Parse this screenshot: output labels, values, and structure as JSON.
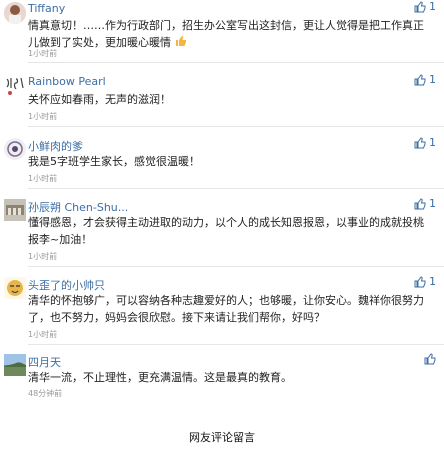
{
  "comments": [
    {
      "user": "Tiffany",
      "text": "情真意切！……作为行政部门，招生办公室写出这封信，更让人觉得是把工作真正儿做到了实处，更加暖心暖情",
      "emoji": "thumbs-up-icon",
      "time": "1小时前",
      "likes": "1"
    },
    {
      "user": "Rainbow Pearl",
      "text": "关怀应如春雨，无声的滋润！",
      "time": "1小时前",
      "likes": "1"
    },
    {
      "user": "小鲜肉的爹",
      "text": "我是5字班学生家长，感觉很温暖！",
      "time": "1小时前",
      "likes": "1"
    },
    {
      "user": "孙辰朔 Chen-Shu...",
      "text": "懂得感恩，才会获得主动进取的动力，以个人的成长知恩报恩，以事业的成就投桃报李~加油！",
      "time": "1小时前",
      "likes": "1"
    },
    {
      "user": "头歪了的小帅只",
      "text": "清华的怀抱够广，可以容纳各种志趣爱好的人；也够暖，让你安心。魏祥你很努力了，也不努力，妈妈会很欣慰。接下来请让我们帮你，好吗？",
      "time": "1小时前",
      "likes": "1"
    },
    {
      "user": "四月天",
      "text": "清华一流，不止理性，更充满温情。这是最真的教育。",
      "time": "48分钟前",
      "likes": ""
    }
  ],
  "caption": "网友评论留言",
  "colors": {
    "name": "#3b6ea5",
    "like": "#3b6ea5"
  }
}
